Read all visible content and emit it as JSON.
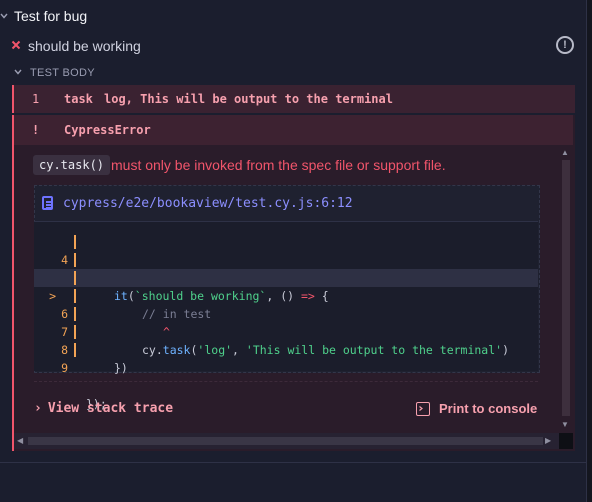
{
  "suite": {
    "title": "Test for bug"
  },
  "test": {
    "title": "should be working",
    "info_glyph": "!"
  },
  "section": {
    "label": "TEST BODY"
  },
  "command": {
    "number": "1",
    "name": "task",
    "message": "log, This will be output to the terminal"
  },
  "error": {
    "bang": "!",
    "name": "CypressError",
    "code_token": "cy.task()",
    "message": "must only be invoked from the spec file or support file."
  },
  "code_frame": {
    "file": "cypress/e2e/bookaview/test.cy.js:6:12",
    "lines": [
      {
        "num": "4",
        "marker": ""
      },
      {
        "num": "5",
        "marker": ""
      },
      {
        "num": "6",
        "marker": ">"
      },
      {
        "num": "",
        "marker": ""
      },
      {
        "num": "7",
        "marker": ""
      },
      {
        "num": "8",
        "marker": ""
      },
      {
        "num": "9",
        "marker": ""
      }
    ],
    "tokens": {
      "l4_kw": "it",
      "l4_str": "`should be working`",
      "l4_rest": ", () ",
      "l4_arrow": "=>",
      "l4_end": " {",
      "l5_comment": "// in test",
      "l6_obj": "cy.",
      "l6_fn": "task",
      "l6_open": "(",
      "l6_str1": "'log'",
      "l6_sep": ", ",
      "l6_str2": "'This will be output to the terminal'",
      "l6_close": ")",
      "caret": "^",
      "l7": "})",
      "l9": "});"
    }
  },
  "actions": {
    "stack_trace": "View stack trace",
    "print_console": "Print to console"
  },
  "colors": {
    "error": "#f1556b",
    "link": "#8c8fff",
    "gutter": "#f2a355",
    "string": "#4fd18c"
  }
}
